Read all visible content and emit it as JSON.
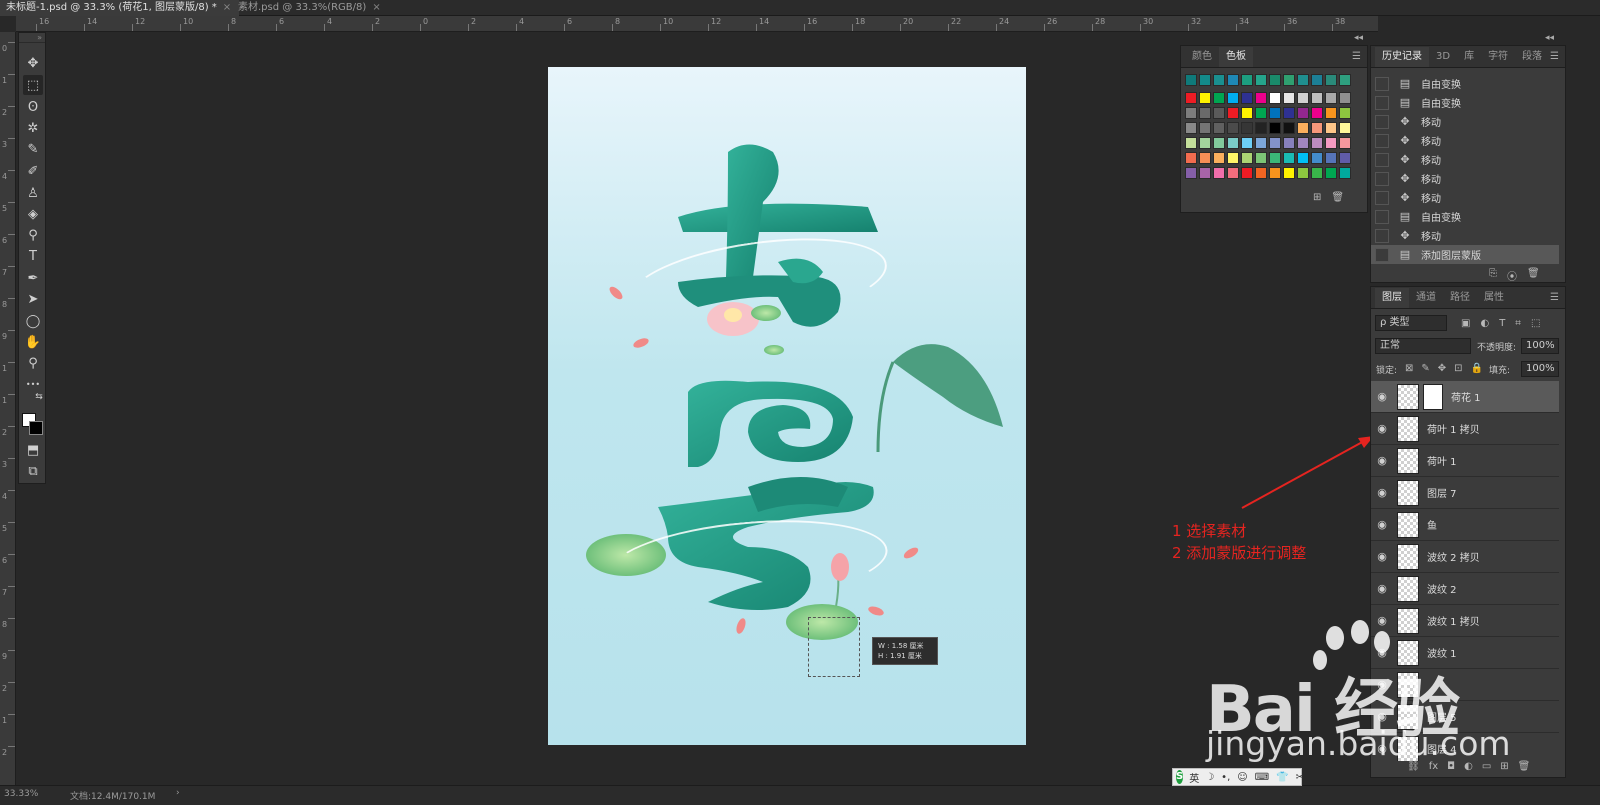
{
  "tabs": [
    {
      "label": "未标题-1.psd @ 33.3% (荷花1, 图层蒙版/8) *",
      "close": "×"
    },
    {
      "label": "素材.psd @ 33.3%(RGB/8)",
      "close": "×"
    }
  ],
  "ruler_top_numbers": [
    "16",
    "14",
    "12",
    "10",
    "8",
    "6",
    "4",
    "2",
    "0",
    "2",
    "4",
    "6",
    "8",
    "10",
    "12",
    "14",
    "16",
    "18",
    "20",
    "22",
    "24",
    "26",
    "28",
    "30",
    "32",
    "34",
    "36",
    "38",
    "40"
  ],
  "ruler_left_numbers": [
    "0",
    "1",
    "2",
    "3",
    "4",
    "5",
    "6",
    "7",
    "8",
    "9",
    "1",
    "1",
    "2",
    "3",
    "4",
    "5",
    "6",
    "7",
    "8",
    "9",
    "2",
    "1",
    "2"
  ],
  "toolbar": {
    "collapse": "»",
    "tools": [
      {
        "name": "move-tool",
        "glyph": "✥"
      },
      {
        "name": "marquee-tool",
        "glyph": "⬚"
      },
      {
        "name": "lasso-tool",
        "glyph": "ʘ"
      },
      {
        "name": "magic-wand-tool",
        "glyph": "✲"
      },
      {
        "name": "eyedropper-tool",
        "glyph": "✎"
      },
      {
        "name": "brush-tool",
        "glyph": "✐"
      },
      {
        "name": "stamp-tool",
        "glyph": "♙"
      },
      {
        "name": "eraser-tool",
        "glyph": "◈"
      },
      {
        "name": "paint-bucket-tool",
        "glyph": "⚲"
      },
      {
        "name": "type-tool",
        "glyph": "T"
      },
      {
        "name": "pen-tool",
        "glyph": "✒"
      },
      {
        "name": "path-selection-tool",
        "glyph": "➤"
      },
      {
        "name": "ellipse-tool",
        "glyph": "◯"
      },
      {
        "name": "hand-tool",
        "glyph": "✋"
      },
      {
        "name": "zoom-tool",
        "glyph": "⚲"
      },
      {
        "name": "more-tools",
        "glyph": "•••"
      },
      {
        "name": "swap-colors",
        "glyph": "⇆"
      },
      {
        "name": "color-swatch",
        "glyph": ""
      },
      {
        "name": "quick-mask",
        "glyph": "⬒"
      },
      {
        "name": "screen-mode",
        "glyph": "⧉"
      }
    ]
  },
  "transform_tip": {
    "w": "W :  1.58 厘米",
    "h": "H :  1.91 厘米"
  },
  "annotation": {
    "line1": "1 选择素材",
    "line2": "2 添加蒙版进行调整"
  },
  "watermark": {
    "brand": "Bai 经验",
    "url": "jingyan.baidu.com"
  },
  "swatches_panel": {
    "tabs": [
      "颜色",
      "色板"
    ],
    "active_tab": 1,
    "menu": "☰",
    "collapse": "◂◂",
    "rows": [
      [
        "#0f7a7a",
        "#138a8a",
        "#1a9090",
        "#1e88b5",
        "#1c9e80",
        "#25a58c",
        "#1a8a6a",
        "#2fa070",
        "#1f8f8f",
        "#1c7f96",
        "#2a8a7a",
        "#2e9f7f"
      ],
      [
        "#ed1c24",
        "#fff200",
        "#00a651",
        "#00aeef",
        "#2e3192",
        "#ec008c",
        "#ffffff",
        "#e6e6e6",
        "#d0d0d0",
        "#bfbfbf",
        "#a8a8a8",
        "#909090"
      ],
      [
        "#7d7d7d",
        "#6a6a6a",
        "#5a5a5a",
        "#ed1c24",
        "#fff200",
        "#00a651",
        "#0072bc",
        "#2e3192",
        "#92278f",
        "#ec008c",
        "#f7941d",
        "#8dc63f"
      ],
      [
        "#898989",
        "#747474",
        "#606060",
        "#4b4b4b",
        "#363636",
        "#232323",
        "#000000",
        "#111111",
        "#fbaf5d",
        "#f7977a",
        "#fdc689",
        "#fff79a"
      ],
      [
        "#c4df9b",
        "#a3d39c",
        "#82ca9c",
        "#7accc8",
        "#6dcff6",
        "#7da7d9",
        "#8393ca",
        "#8781bd",
        "#a186be",
        "#bd8cbf",
        "#f49ac1",
        "#f5989d"
      ],
      [
        "#f26c4f",
        "#f68e56",
        "#fbaf5d",
        "#fff568",
        "#acd373",
        "#7cc576",
        "#3bb878",
        "#1abbb4",
        "#00bff3",
        "#438ccb",
        "#5674b9",
        "#605ca8"
      ],
      [
        "#855fa8",
        "#a864a8",
        "#f06eaa",
        "#f26d7d",
        "#ed1c24",
        "#f26522",
        "#f7941d",
        "#fff200",
        "#8dc63f",
        "#39b54a",
        "#00a651",
        "#00a99d"
      ]
    ]
  },
  "history_panel": {
    "tabs": [
      "历史记录",
      "3D",
      "库",
      "字符",
      "段落"
    ],
    "active_tab": 0,
    "menu": "☰",
    "collapse": "◂◂",
    "items": [
      {
        "label": "自由变换",
        "icon": "doc-icon",
        "glyph": "▤"
      },
      {
        "label": "自由变换",
        "icon": "doc-icon",
        "glyph": "▤"
      },
      {
        "label": "移动",
        "icon": "move-icon",
        "glyph": "✥"
      },
      {
        "label": "移动",
        "icon": "move-icon",
        "glyph": "✥"
      },
      {
        "label": "移动",
        "icon": "move-icon",
        "glyph": "✥"
      },
      {
        "label": "移动",
        "icon": "move-icon",
        "glyph": "✥"
      },
      {
        "label": "移动",
        "icon": "move-icon",
        "glyph": "✥"
      },
      {
        "label": "自由变换",
        "icon": "doc-icon",
        "glyph": "▤"
      },
      {
        "label": "移动",
        "icon": "move-icon",
        "glyph": "✥"
      },
      {
        "label": "添加图层蒙版",
        "icon": "doc-icon",
        "glyph": "▤"
      }
    ],
    "active_index": 9,
    "footer_icons": [
      "⎘",
      "⦿",
      "🗑"
    ]
  },
  "layers_panel": {
    "tabs": [
      "图层",
      "通道",
      "路径",
      "属性"
    ],
    "active_tab": 0,
    "menu": "☰",
    "filter_label": "ρ 类型",
    "filter_icons": [
      "▣",
      "◐",
      "T",
      "⌗",
      "⬚"
    ],
    "blend_mode": "正常",
    "opacity_label": "不透明度:",
    "opacity_value": "100%",
    "lock_label": "锁定:",
    "lock_icons": [
      "⊠",
      "✎",
      "✥",
      "⊡",
      "🔒"
    ],
    "fill_label": "填充:",
    "fill_value": "100%",
    "eye": "◉",
    "layers": [
      {
        "name": "荷花 1",
        "has_mask": true
      },
      {
        "name": "荷叶 1 拷贝",
        "has_mask": false
      },
      {
        "name": "荷叶 1",
        "has_mask": false
      },
      {
        "name": "图层 7",
        "has_mask": false
      },
      {
        "name": "鱼",
        "has_mask": false
      },
      {
        "name": "波纹 2 拷贝",
        "has_mask": false
      },
      {
        "name": "波纹 2",
        "has_mask": false
      },
      {
        "name": "波纹 1 拷贝",
        "has_mask": false
      },
      {
        "name": "波纹 1",
        "has_mask": false
      },
      {
        "name": "",
        "has_mask": false
      },
      {
        "name": "图层 5",
        "has_mask": false
      },
      {
        "name": "图层 4",
        "has_mask": false
      }
    ],
    "active_index": 0,
    "footer_icons": [
      "⛓",
      "fx",
      "◘",
      "◐",
      "▭",
      "⊞",
      "🗑"
    ]
  },
  "statusbar": {
    "zoom": "33.33%",
    "doc": "文档:12.4M/170.1M",
    "arrow": "›"
  },
  "ime": {
    "logo": "S",
    "lang": "英",
    "icons": [
      "☽",
      "•,",
      "☺",
      "⌨",
      "👕",
      "✂"
    ]
  },
  "colors": {
    "annotation": "#e52420",
    "canvas_top": "#e8f5fb",
    "canvas_bottom": "#b7e2ec",
    "teal": "#1f9a86"
  }
}
